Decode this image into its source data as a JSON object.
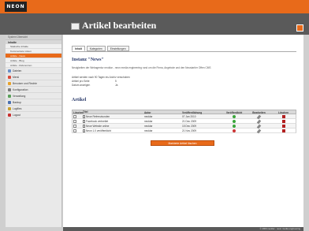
{
  "app": {
    "logo": "NEON"
  },
  "header": {
    "title": "Artikel bearbeiten"
  },
  "sidebar": {
    "top": "System Übersicht",
    "group": "Inhalte",
    "subitems": [
      {
        "label": "Statische Inhalte",
        "active": false
      },
      {
        "label": "Kommentare Listen",
        "active": false
      },
      {
        "label": "Artikle - News",
        "active": true
      },
      {
        "label": "Artikle - Blog",
        "active": false
      },
      {
        "label": "Artikle - Referenzen",
        "active": false
      }
    ],
    "items": [
      {
        "label": "Dateien",
        "color": "#6a8fc8"
      },
      {
        "label": "Menü",
        "color": "#d94a3a"
      },
      {
        "label": "Benutzer und Rechte",
        "color": "#e8a22a"
      },
      {
        "label": "Konfiguration",
        "color": "#7a7a7a"
      },
      {
        "label": "Verwaltung",
        "color": "#5aa05a"
      },
      {
        "label": "Backup",
        "color": "#4a70b0"
      },
      {
        "label": "Logfiles",
        "color": "#c8a030"
      },
      {
        "label": "Logout",
        "color": "#c83030"
      }
    ]
  },
  "tabs": [
    "Inhalt",
    "Kategorien",
    "Einstellungen"
  ],
  "instance": {
    "heading": "Instanz \"News\"",
    "description": "Neuigkeiten der Webagentur neoklar - neon media engineering rund um die Firma, Angebote und den Neustart/er Offen CMS",
    "meta": [
      {
        "key": "Artikel werden nach 90 Tagen ins Archiv verschoben",
        "value": ""
      },
      {
        "key": "Artikel pro Seite",
        "value": "5"
      },
      {
        "key": "Datum anzeigen",
        "value": "Ja"
      }
    ]
  },
  "articles": {
    "heading": "Artikel",
    "columns": [
      "Löschen",
      "Titel",
      "Autor",
      "Veröffentlichung",
      "Veröffentlicht",
      "Bearbeiten",
      "Löschen"
    ],
    "rows": [
      {
        "title": "Neue Refrenzkunden",
        "author": "neoklar",
        "date": "07 Jan 2010",
        "published": true
      },
      {
        "title": "Facebook verbreitet",
        "author": "neoklar",
        "date": "21 Dec 2009",
        "published": true
      },
      {
        "title": "Neue Website online",
        "author": "neoklar",
        "date": "15 Dec 2009",
        "published": true
      },
      {
        "title": "Neon 1.0 veröffentlicht",
        "author": "neoklar",
        "date": "21 Nov 2009",
        "published": false
      }
    ],
    "new_button": "Markierte Artikel löschen"
  },
  "footer": {
    "text": "© 2009 neoklar - neon media engineering"
  }
}
